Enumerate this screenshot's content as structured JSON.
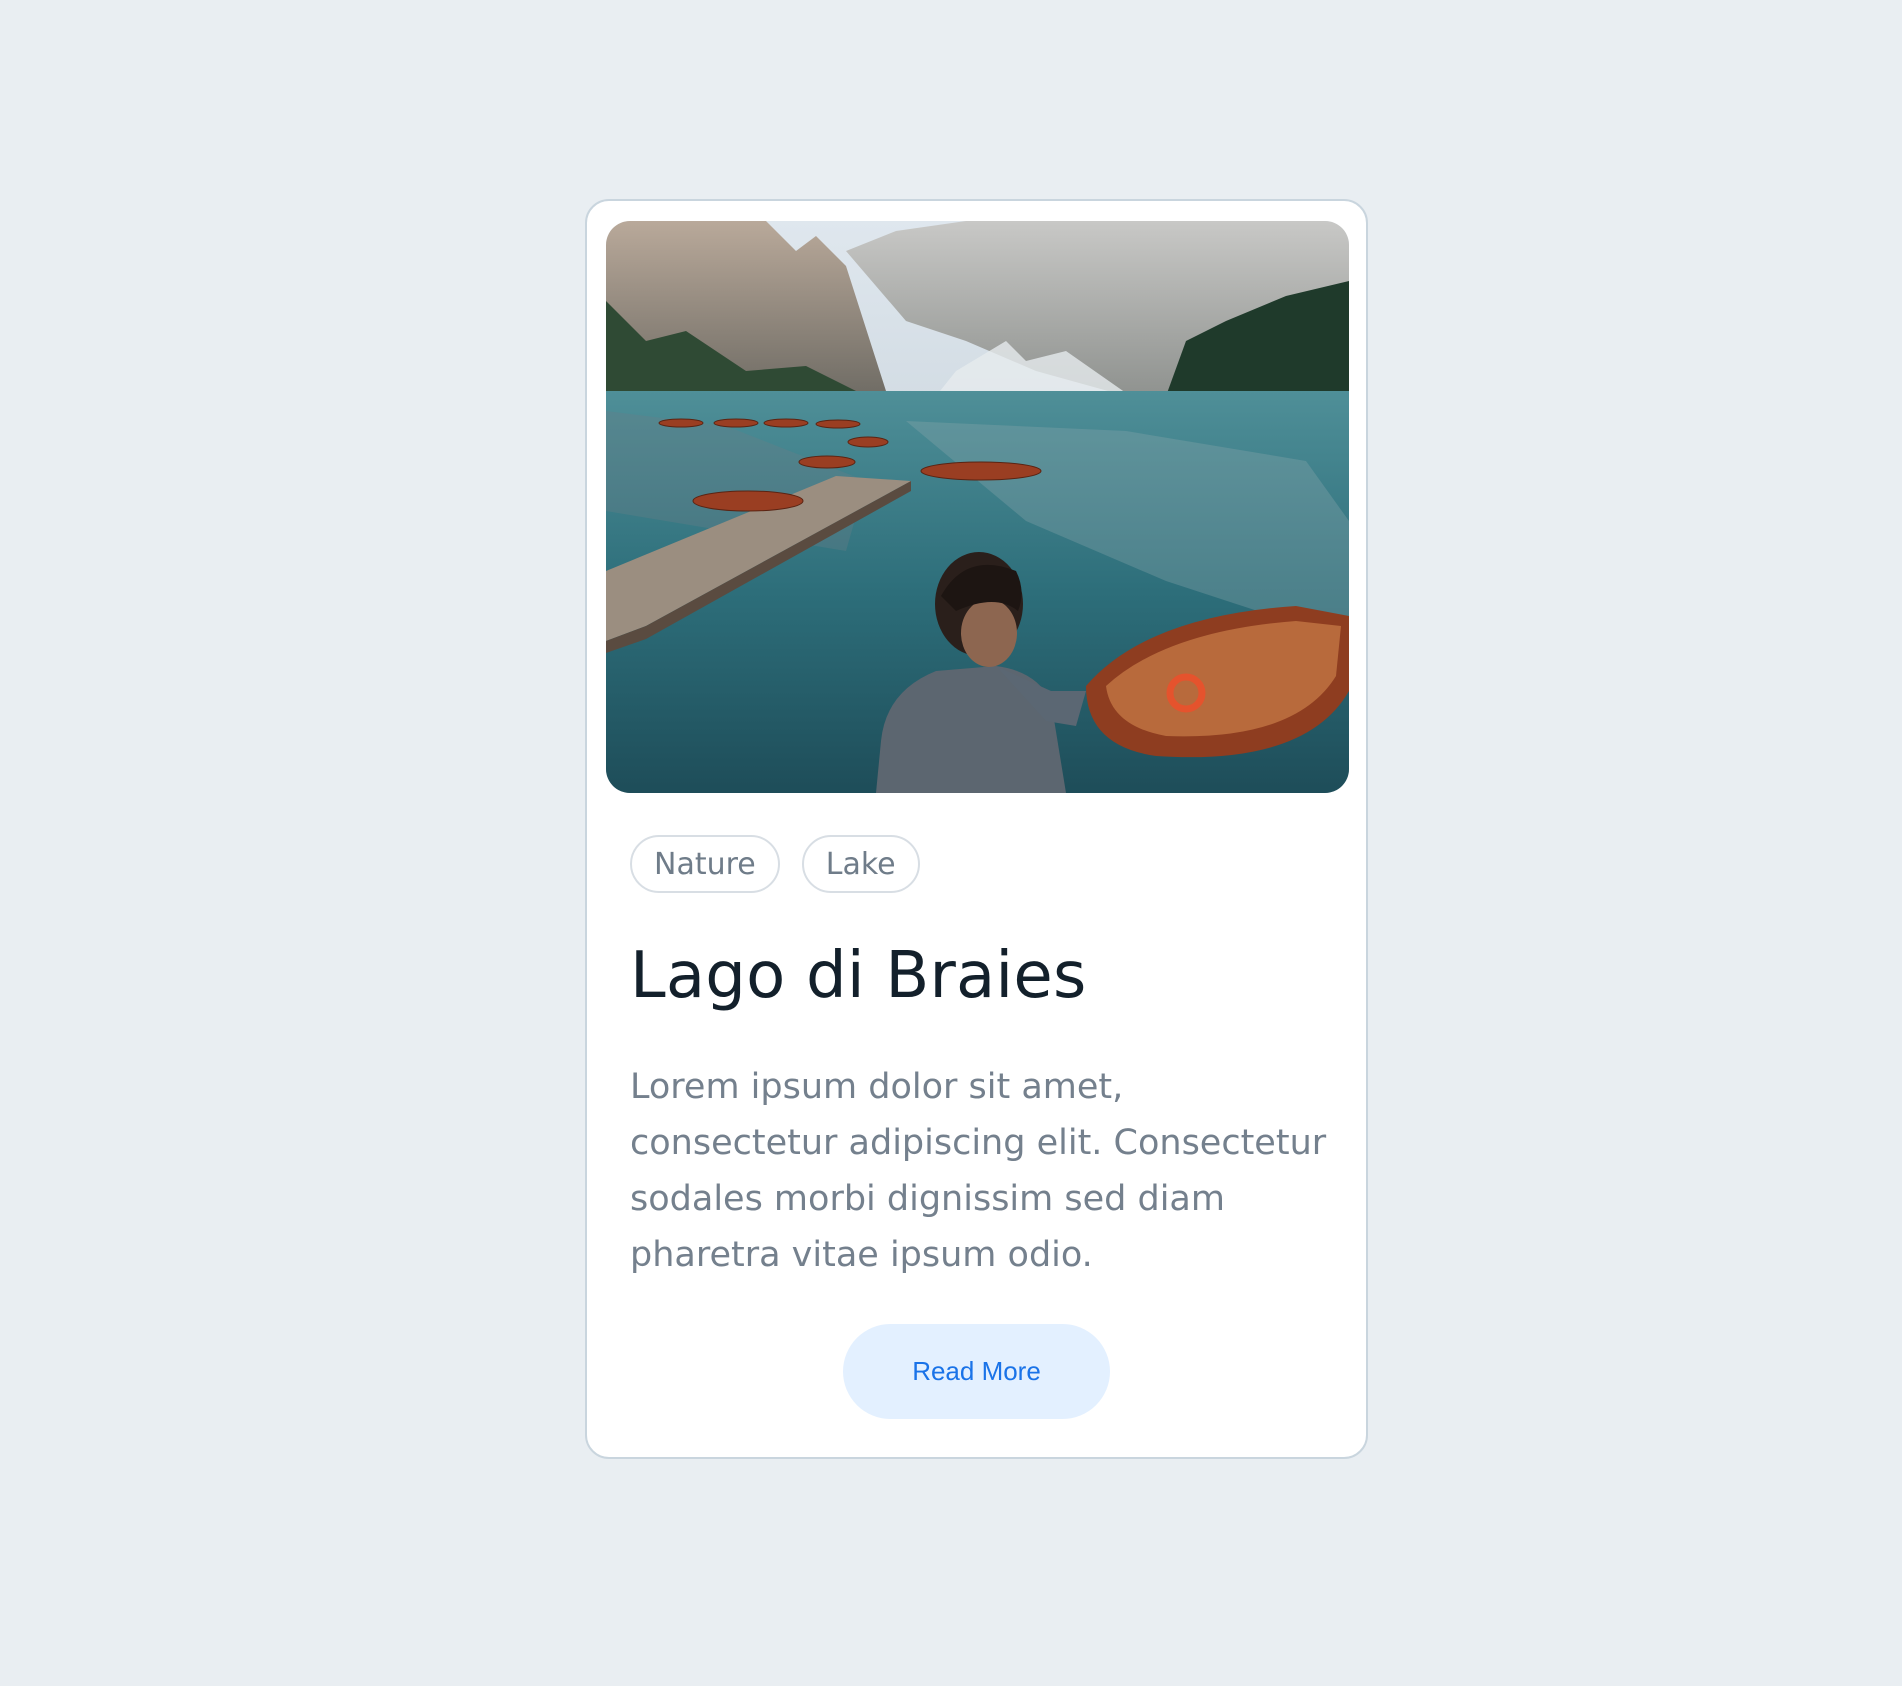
{
  "card": {
    "tags": [
      {
        "label": "Nature"
      },
      {
        "label": "Lake"
      }
    ],
    "title": "Lago di Braies",
    "description": "Lorem ipsum dolor sit amet, consectetur adipiscing elit. Consectetur sodales morbi dignissim sed diam pharetra vitae ipsum odio.",
    "cta_label": "Read More",
    "colors": {
      "page_bg": "#e9eef2",
      "card_bg": "#ffffff",
      "card_border": "#c9d5de",
      "title": "#13202b",
      "body_text": "#74808d",
      "cta_bg": "#e3f0ff",
      "cta_text": "#1a73e8"
    },
    "image_subject": "lake-mountains-boats-photo"
  }
}
